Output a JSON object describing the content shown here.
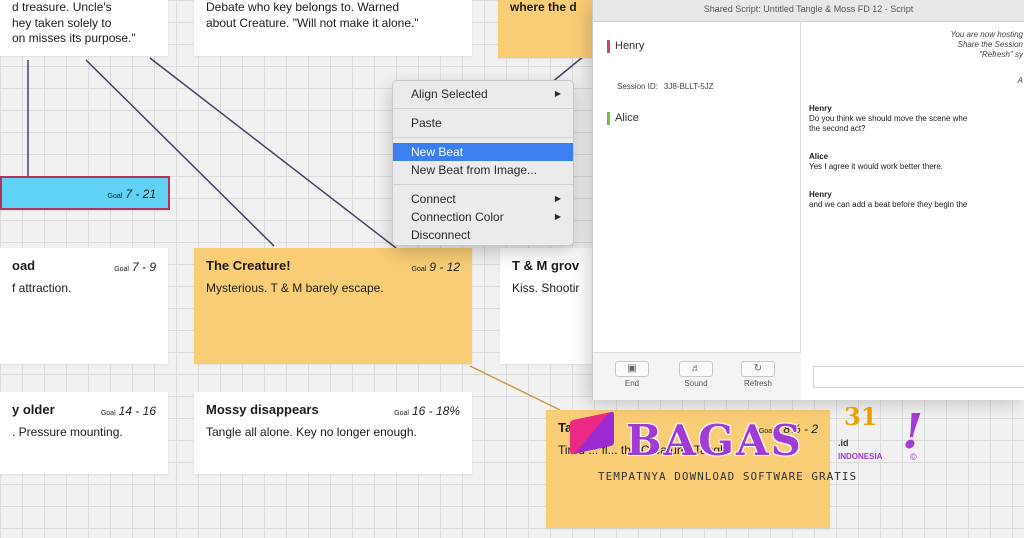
{
  "board": {
    "cards": [
      {
        "id": "c-top-left",
        "desc_lines": [
          "d treasure. Uncle's",
          "hey taken solely to",
          "on misses its purpose.\""
        ]
      },
      {
        "id": "c-top-mid",
        "desc_lines": [
          "Debate who key belongs to. Warned",
          "about Creature. \"Will not make it alone.\""
        ]
      },
      {
        "id": "c-top-right",
        "desc_lines": [
          "where the d"
        ]
      },
      {
        "id": "c-blue",
        "goal": "7 - 21"
      },
      {
        "id": "c-road",
        "title": "oad",
        "goal": "7 - 9",
        "desc": "f attraction."
      },
      {
        "id": "c-creature",
        "title": "The Creature!",
        "goal": "9 - 12",
        "desc": "Mysterious. T & M barely escape."
      },
      {
        "id": "c-tm",
        "title": "T & M grov",
        "desc": "Kiss. Shootir"
      },
      {
        "id": "c-older",
        "title": "y older",
        "goal": "14 - 16",
        "desc": ". Pressure mounting."
      },
      {
        "id": "c-mossy",
        "title": "Mossy disappears",
        "goal": "16 - 18%",
        "desc": "Tangle all alone. Key no longer enough."
      },
      {
        "id": "c-tangle",
        "title": "Ta",
        "goal": "18% - 2",
        "desc": "Tired ... fl... the Creature. Tangle"
      }
    ],
    "goal_label": "Goal"
  },
  "context_menu": {
    "items": [
      {
        "label": "Align Selected",
        "submenu": true
      },
      {
        "label": "Paste"
      },
      {
        "label": "New Beat",
        "highlighted": true
      },
      {
        "label": "New Beat from Image..."
      },
      {
        "label": "Connect",
        "submenu": true
      },
      {
        "label": "Connection Color",
        "submenu": true
      },
      {
        "label": "Disconnect"
      }
    ]
  },
  "script_window": {
    "title": "Shared Script: Untitled Tangle & Moss FD 12 - Script",
    "users": [
      {
        "name": "Henry",
        "color": "#d0427a"
      },
      {
        "name": "Alice",
        "color": "#6cc04a"
      }
    ],
    "session_label": "Session ID:",
    "session_id": "3J8-BLLT-5JZ",
    "toolbar": {
      "end_label": "End",
      "sound_label": "Sound",
      "refresh_label": "Refresh"
    },
    "notice_lines": [
      "You are now hosting",
      "Share the Session",
      "\"Refresh\" sy",
      "A"
    ],
    "chat": [
      {
        "who": "Henry",
        "lines": [
          "Do you think we should move the scene whe",
          "the second act?"
        ]
      },
      {
        "who": "Alice",
        "lines": [
          "Yes I agree it would work better there."
        ]
      },
      {
        "who": "Henry",
        "lines": [
          "and we can add a beat before they begin the"
        ]
      }
    ]
  },
  "watermark": {
    "main": "BAGAS",
    "number": "31",
    "domain": ".id",
    "country": "INDONESIA",
    "exclaim": "!",
    "copyright": "©",
    "tagline": "TEMPATNYA DOWNLOAD SOFTWARE GRATIS"
  },
  "colors": {
    "card_yellow": "#f9cd75",
    "card_blue": "#5fd2f5",
    "card_blue_border": "#b03558",
    "menu_highlight": "#3b7ff0"
  }
}
